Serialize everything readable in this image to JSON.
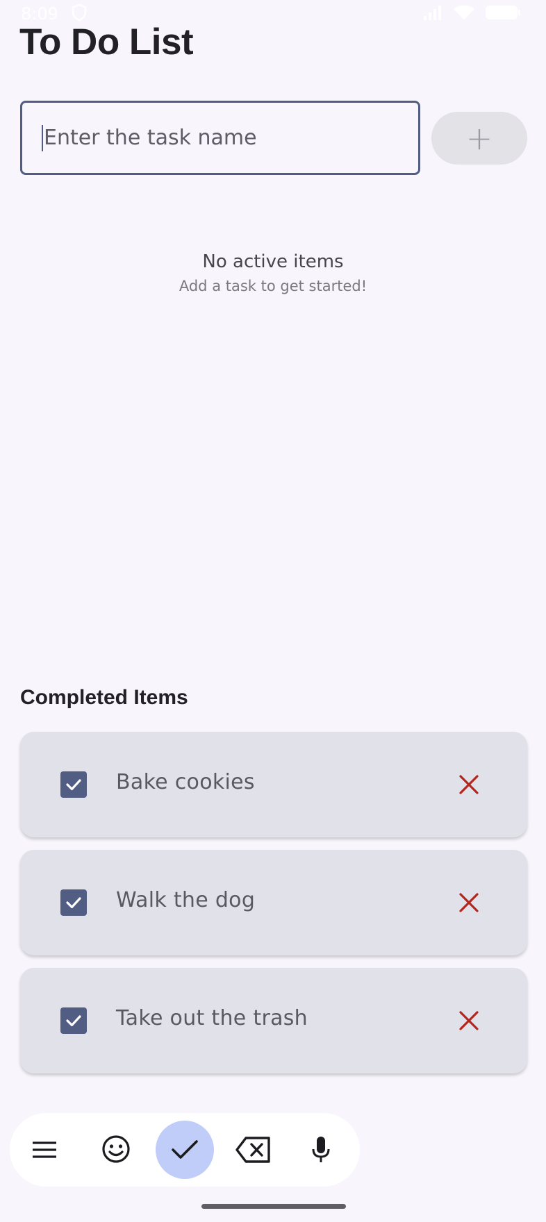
{
  "status_bar": {
    "time": "8:09"
  },
  "header": {
    "title": "To Do List"
  },
  "task_input": {
    "placeholder": "Enter the task name",
    "value": ""
  },
  "add_button": {
    "label": "+"
  },
  "empty_state": {
    "title": "No active items",
    "subtitle": "Add a task to get started!"
  },
  "completed": {
    "title": "Completed Items",
    "items": [
      {
        "label": "Bake cookies",
        "checked": true
      },
      {
        "label": "Walk the dog",
        "checked": true
      },
      {
        "label": "Take out the trash",
        "checked": true
      }
    ]
  },
  "keyboard_toolbar": {
    "icons": [
      "menu-icon",
      "emoji-icon",
      "check-icon",
      "backspace-icon",
      "microphone-icon"
    ]
  },
  "colors": {
    "accent": "#525d83",
    "delete": "#b3261e",
    "background": "#f8f6fc",
    "card": "#e1e1ea",
    "active_key": "#c0cdf9"
  }
}
